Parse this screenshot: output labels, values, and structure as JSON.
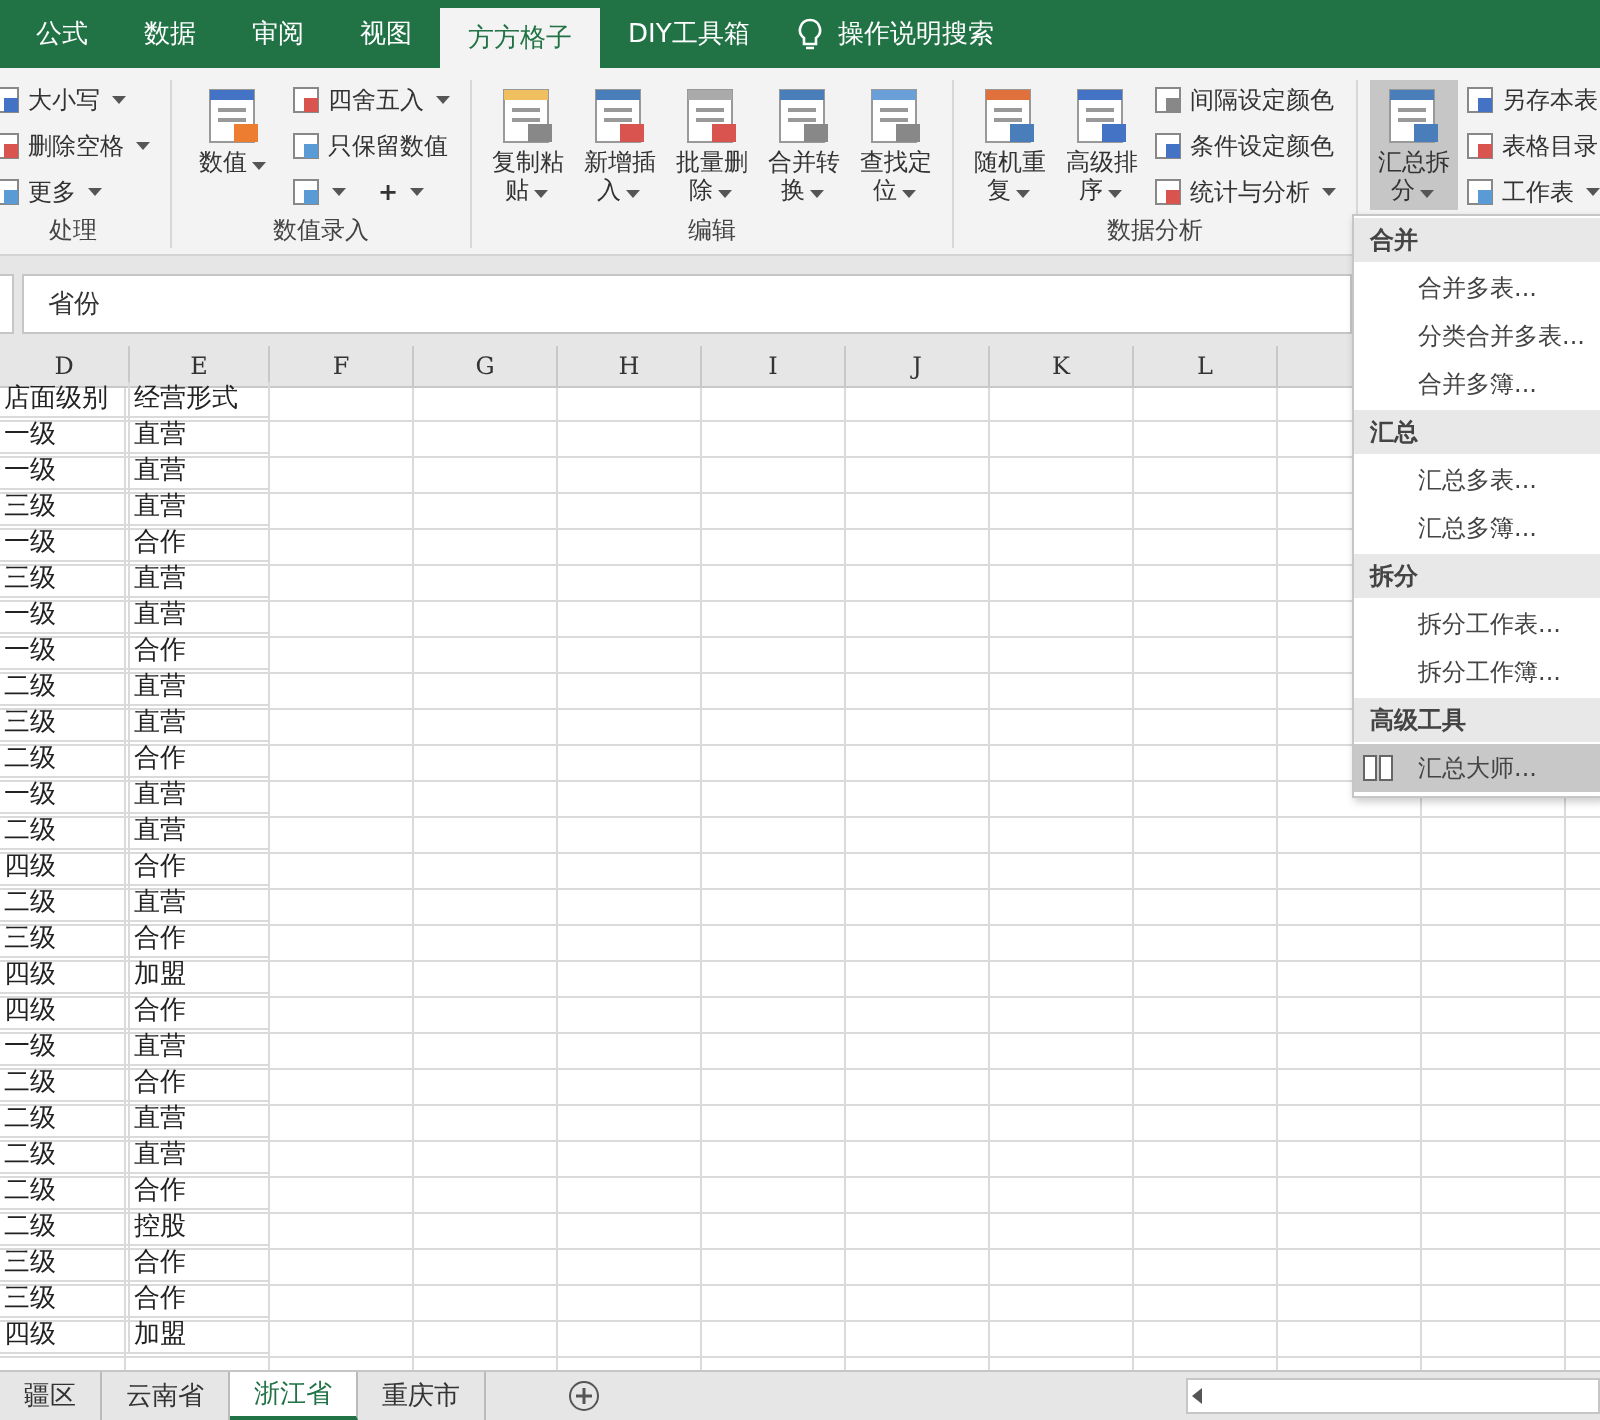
{
  "tabs": [
    {
      "label": "公式",
      "selected": false
    },
    {
      "label": "数据",
      "selected": false
    },
    {
      "label": "审阅",
      "selected": false
    },
    {
      "label": "视图",
      "selected": false
    },
    {
      "label": "方方格子",
      "selected": true
    },
    {
      "label": "DIY工具箱",
      "selected": false
    }
  ],
  "tell_me": "操作说明搜索",
  "ribbon": {
    "groups": [
      {
        "label": "处理",
        "small": [
          {
            "label": "大小写",
            "dropdown": true
          },
          {
            "label": "删除空格",
            "dropdown": true
          },
          {
            "label": "更多",
            "dropdown": true
          }
        ]
      },
      {
        "label": "数值录入",
        "large": [
          {
            "label": "数值",
            "dropdown": true,
            "selected": false
          }
        ],
        "small": [
          {
            "label": "四舍五入",
            "dropdown": true
          },
          {
            "label": "只保留数值",
            "dropdown": false
          }
        ],
        "extra": [
          {
            "label": "+",
            "dropdown": true
          }
        ]
      },
      {
        "label": "编辑",
        "large": [
          {
            "label": "复制粘贴",
            "dropdown": true,
            "selected": false
          },
          {
            "label": "新增插入",
            "dropdown": true,
            "selected": false
          },
          {
            "label": "批量删除",
            "dropdown": true,
            "selected": false
          },
          {
            "label": "合并转换",
            "dropdown": true,
            "selected": false
          },
          {
            "label": "查找定位",
            "dropdown": true,
            "selected": false
          }
        ]
      },
      {
        "label": "数据分析",
        "large": [
          {
            "label": "随机重复",
            "dropdown": true,
            "selected": false
          },
          {
            "label": "高级排序",
            "dropdown": true,
            "selected": false
          }
        ],
        "small": [
          {
            "label": "间隔设定颜色",
            "dropdown": false
          },
          {
            "label": "条件设定颜色",
            "dropdown": false
          },
          {
            "label": "统计与分析",
            "dropdown": true
          }
        ]
      },
      {
        "large": [
          {
            "label": "汇总拆分",
            "dropdown": true,
            "selected": true
          }
        ],
        "small": [
          {
            "label": "另存本表",
            "dropdown": false
          },
          {
            "label": "表格目录",
            "dropdown": false
          },
          {
            "label": "工作表",
            "dropdown": true
          }
        ]
      }
    ]
  },
  "formula_bar": {
    "value": "省份"
  },
  "columns": [
    "D",
    "E",
    "F",
    "G",
    "H",
    "I",
    "J",
    "K",
    "L"
  ],
  "rows": [
    [
      "店面级别",
      "经营形式"
    ],
    [
      "一级",
      "直营"
    ],
    [
      "一级",
      "直营"
    ],
    [
      "三级",
      "直营"
    ],
    [
      "一级",
      "合作"
    ],
    [
      "三级",
      "直营"
    ],
    [
      "一级",
      "直营"
    ],
    [
      "一级",
      "合作"
    ],
    [
      "二级",
      "直营"
    ],
    [
      "三级",
      "直营"
    ],
    [
      "二级",
      "合作"
    ],
    [
      "一级",
      "直营"
    ],
    [
      "二级",
      "直营"
    ],
    [
      "四级",
      "合作"
    ],
    [
      "二级",
      "直营"
    ],
    [
      "三级",
      "合作"
    ],
    [
      "四级",
      "加盟"
    ],
    [
      "四级",
      "合作"
    ],
    [
      "一级",
      "直营"
    ],
    [
      "二级",
      "合作"
    ],
    [
      "二级",
      "直营"
    ],
    [
      "二级",
      "直营"
    ],
    [
      "二级",
      "合作"
    ],
    [
      "二级",
      "控股"
    ],
    [
      "三级",
      "合作"
    ],
    [
      "三级",
      "合作"
    ],
    [
      "四级",
      "加盟"
    ]
  ],
  "menu": {
    "sections": [
      {
        "header": "合并",
        "items": [
          {
            "label": "合并多表...",
            "selected": false
          },
          {
            "label": "分类合并多表...",
            "selected": false
          },
          {
            "label": "合并多簿...",
            "selected": false
          }
        ]
      },
      {
        "header": "汇总",
        "items": [
          {
            "label": "汇总多表...",
            "selected": false
          },
          {
            "label": "汇总多簿...",
            "selected": false
          }
        ]
      },
      {
        "header": "拆分",
        "items": [
          {
            "label": "拆分工作表...",
            "selected": false
          },
          {
            "label": "拆分工作簿...",
            "selected": false
          }
        ]
      },
      {
        "header": "高级工具",
        "items": [
          {
            "label": "汇总大师...",
            "selected": true,
            "kind": "icon"
          }
        ]
      }
    ]
  },
  "sheets": [
    {
      "label": "疆区",
      "selected": false
    },
    {
      "label": "云南省",
      "selected": false
    },
    {
      "label": "浙江省",
      "selected": true
    },
    {
      "label": "重庆市",
      "selected": false
    }
  ]
}
